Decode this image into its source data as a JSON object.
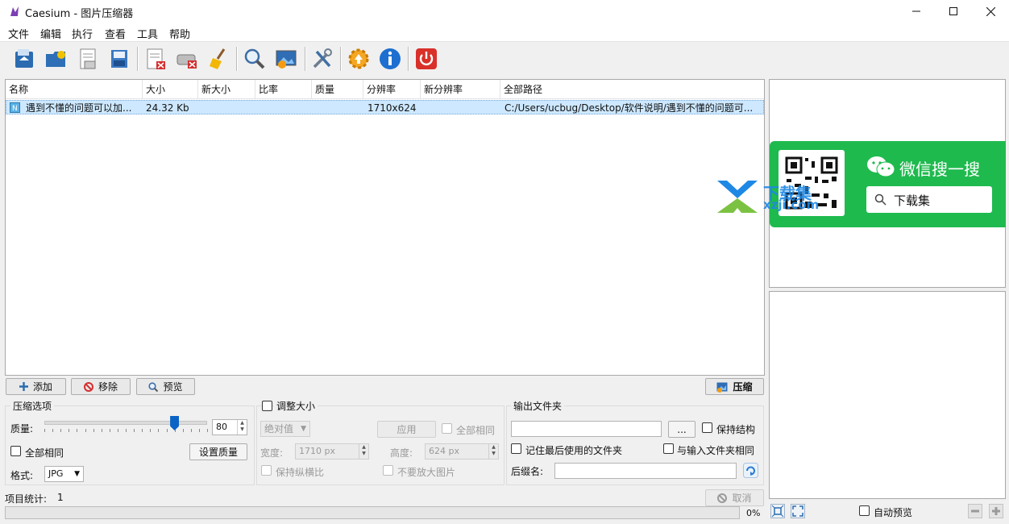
{
  "window": {
    "title": "Caesium - 图片压缩器"
  },
  "menu": [
    "文件",
    "编辑",
    "执行",
    "查看",
    "工具",
    "帮助"
  ],
  "toolbar_icons": [
    "open-file-icon",
    "open-folder-icon",
    "save-list-icon",
    "export-list-icon",
    "remove-item-icon",
    "clear-list-icon",
    "clean-icon",
    "preview-zoom-icon",
    "image-settings-icon",
    "tools-icon",
    "update-icon",
    "info-icon",
    "exit-icon"
  ],
  "table": {
    "columns": [
      "名称",
      "大小",
      "新大小",
      "比率",
      "质量",
      "分辨率",
      "新分辨率",
      "全部路径"
    ],
    "rows": [
      {
        "name": "遇到不懂的问题可以加...",
        "size": "24.32 Kb",
        "new_size": "",
        "ratio": "",
        "quality": "",
        "resolution": "1710x624",
        "new_resolution": "",
        "path": "C:/Users/ucbug/Desktop/软件说明/遇到不懂的问题可..."
      }
    ]
  },
  "buttons": {
    "add": "添加",
    "remove": "移除",
    "preview": "预览",
    "compress": "压缩",
    "set_quality": "设置质量",
    "apply": "应用",
    "cancel": "取消",
    "browse": "..."
  },
  "compression": {
    "legend": "压缩选项",
    "quality_label": "质量:",
    "quality_value": "80",
    "quality_fraction": 0.8,
    "same_all": "全部相同",
    "format_label": "格式:",
    "format_value": "JPG"
  },
  "resize": {
    "legend": "调整大小",
    "mode": "绝对值",
    "same_all": "全部相同",
    "width_label": "宽度:",
    "width_value": "1710 px",
    "height_label": "高度:",
    "height_value": "624 px",
    "keep_ratio": "保持纵横比",
    "no_enlarge": "不要放大图片"
  },
  "output": {
    "legend": "输出文件夹",
    "keep_structure": "保持结构",
    "remember_last": "记住最后使用的文件夹",
    "same_as_input": "与输入文件夹相同",
    "suffix_label": "后缀名:"
  },
  "status": {
    "count_label": "项目统计:",
    "count_value": "1",
    "progress_text": "0%"
  },
  "preview_panel": {
    "auto_preview": "自动预览"
  },
  "watermark": {
    "wechat_text": "微信搜一搜",
    "search_text": "下载集",
    "site_name": "下载集",
    "site_url": "xzji.com"
  },
  "colors": {
    "selection": "#cde8ff",
    "wechat_green": "#1fba4e",
    "watermark_blue": "#1e88e5"
  }
}
